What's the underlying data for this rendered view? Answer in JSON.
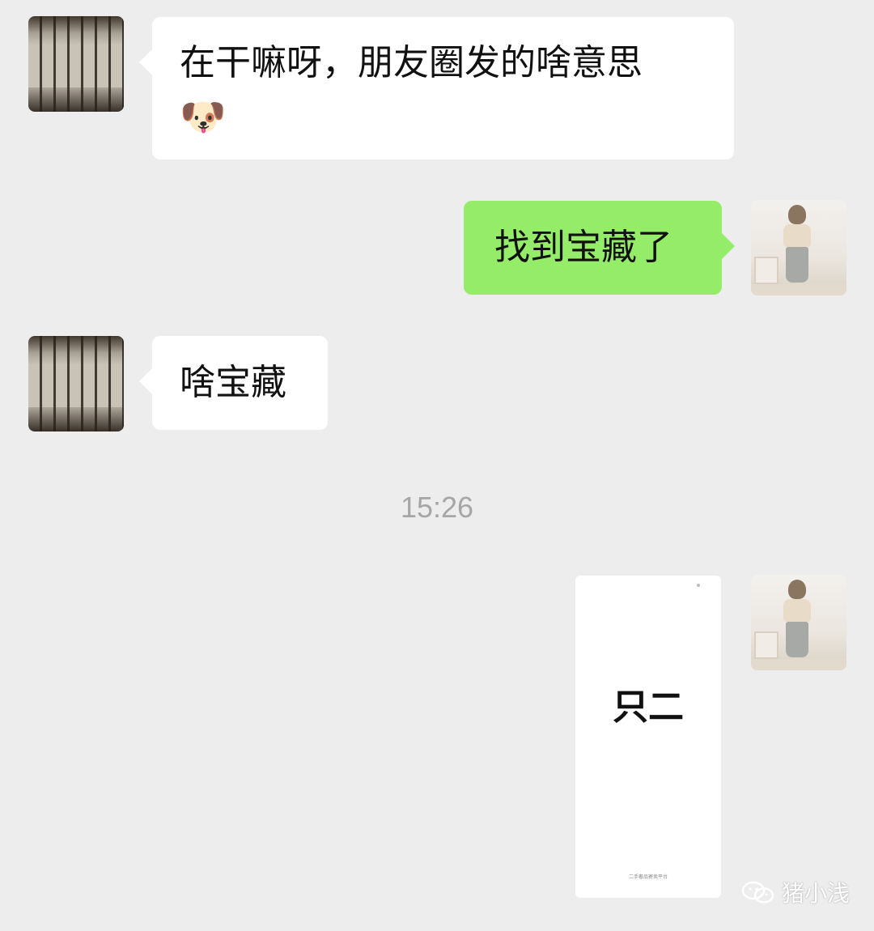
{
  "messages": [
    {
      "sender": "friend",
      "avatar": "room-interior-photo",
      "text": "在干嘛呀，朋友圈发的啥意思",
      "emoji": "🐶"
    },
    {
      "sender": "me",
      "avatar": "girl-photo",
      "text": "找到宝藏了"
    },
    {
      "sender": "friend",
      "avatar": "room-interior-photo",
      "text": "啥宝藏"
    }
  ],
  "timestamp": "15:26",
  "image_message": {
    "sender": "me",
    "avatar": "girl-photo",
    "main_text": "只二",
    "footer_text": "二手奢品寄卖平台"
  },
  "watermark": {
    "icon": "wechat-icon",
    "text": "猪小浅"
  },
  "colors": {
    "background": "#ededed",
    "incoming_bubble": "#ffffff",
    "outgoing_bubble": "#95ec69",
    "timestamp": "#a6a6a6"
  }
}
